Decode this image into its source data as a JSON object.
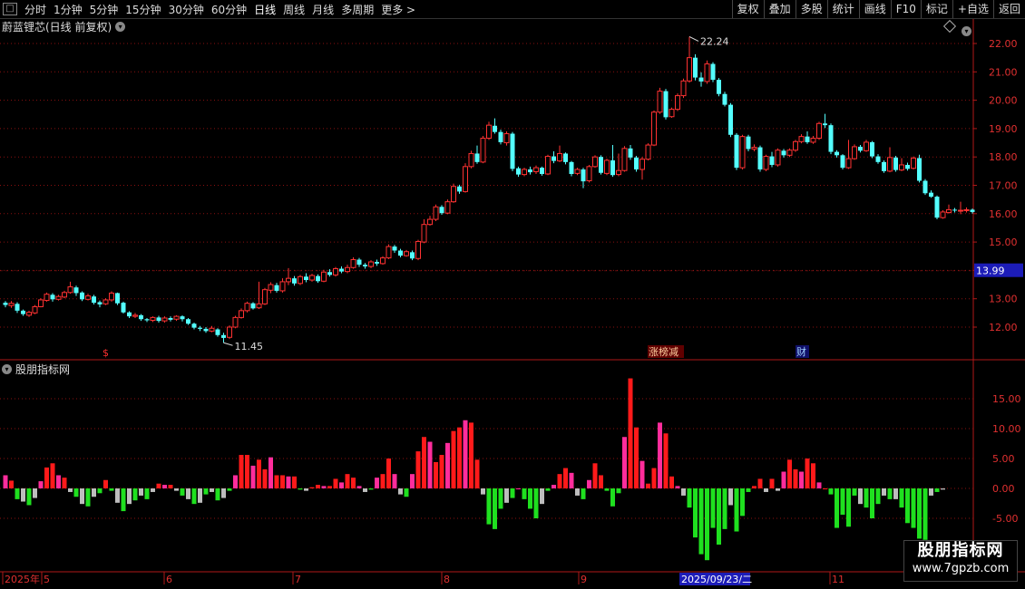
{
  "toolbar": {
    "periods": [
      "分时",
      "1分钟",
      "5分钟",
      "15分钟",
      "30分钟",
      "60分钟",
      "日线",
      "周线",
      "月线",
      "多周期",
      "更多 >"
    ],
    "active": "日线",
    "right_buttons": [
      "复权",
      "叠加",
      "多股",
      "统计",
      "画线",
      "F10",
      "标记",
      "+自选",
      "返回"
    ]
  },
  "title": "蔚蓝锂芯(日线 前复权)",
  "indicator_title": "股朋指标网",
  "price_axis": [
    "22.00",
    "21.00",
    "20.00",
    "19.00",
    "18.00",
    "17.00",
    "16.00",
    "15.00",
    "14.00",
    "13.00",
    "12.00"
  ],
  "indicator_axis": [
    "15.00",
    "10.00",
    "5.00",
    "0.00",
    "-5.00"
  ],
  "current_price": "13.99",
  "high_label": "22.24",
  "low_label": "11.45",
  "markers": {
    "s": "$",
    "zhang": "涨榜减",
    "cai": "财"
  },
  "time_axis": [
    "2025年",
    "5",
    "6",
    "7",
    "8",
    "9",
    "10",
    "11"
  ],
  "crosshair_date": "2025/09/23/二",
  "watermark": {
    "line1": "股朋指标网",
    "line2": "www.7gpzb.com"
  },
  "colors": {
    "up": "#ff3232",
    "down": "#54ffff",
    "pos": "#ff1a1a",
    "pos2": "#ff2d9c",
    "neg": "#1fe01f",
    "neu": "#bdbdbd",
    "grid": "#8a1010"
  },
  "chart_data": {
    "type": "candlestick",
    "ylim_price": [
      11.1,
      22.5
    ],
    "ylim_indicator": [
      -12.5,
      20
    ],
    "candles": [
      [
        12.86,
        12.78,
        12.92,
        12.7
      ],
      [
        12.76,
        12.84,
        12.92,
        12.68
      ],
      [
        12.82,
        12.58,
        12.88,
        12.5
      ],
      [
        12.58,
        12.46,
        12.62,
        12.4
      ],
      [
        12.42,
        12.52,
        12.58,
        12.36
      ],
      [
        12.5,
        12.72,
        12.78,
        12.46
      ],
      [
        12.72,
        12.96,
        13.02,
        12.7
      ],
      [
        12.94,
        13.16,
        13.22,
        12.9
      ],
      [
        13.14,
        12.98,
        13.2,
        12.9
      ],
      [
        12.98,
        13.08,
        13.14,
        12.94
      ],
      [
        13.06,
        13.22,
        13.28,
        13.02
      ],
      [
        13.22,
        13.42,
        13.6,
        13.18
      ],
      [
        13.4,
        13.2,
        13.46,
        13.1
      ],
      [
        13.22,
        12.98,
        13.26,
        12.92
      ],
      [
        12.98,
        13.1,
        13.18,
        12.94
      ],
      [
        13.08,
        12.86,
        13.14,
        12.8
      ],
      [
        12.88,
        12.8,
        12.94,
        12.7
      ],
      [
        12.82,
        12.96,
        13.02,
        12.78
      ],
      [
        12.96,
        13.2,
        13.26,
        12.9
      ],
      [
        13.2,
        12.84,
        13.22,
        12.78
      ],
      [
        12.86,
        12.52,
        12.9,
        12.48
      ],
      [
        12.52,
        12.38,
        12.56,
        12.32
      ],
      [
        12.38,
        12.42,
        12.5,
        12.32
      ],
      [
        12.42,
        12.28,
        12.46,
        12.22
      ],
      [
        12.28,
        12.24,
        12.32,
        12.18
      ],
      [
        12.24,
        12.34,
        12.38,
        12.18
      ],
      [
        12.34,
        12.22,
        12.4,
        12.16
      ],
      [
        12.22,
        12.32,
        12.38,
        12.16
      ],
      [
        12.32,
        12.26,
        12.38,
        12.2
      ],
      [
        12.28,
        12.38,
        12.42,
        12.22
      ],
      [
        12.38,
        12.28,
        12.42,
        12.2
      ],
      [
        12.28,
        12.12,
        12.32,
        12.08
      ],
      [
        12.12,
        11.98,
        12.16,
        11.92
      ],
      [
        11.98,
        11.94,
        12.04,
        11.86
      ],
      [
        11.94,
        11.86,
        12.0,
        11.8
      ],
      [
        11.86,
        11.96,
        12.04,
        11.82
      ],
      [
        11.92,
        11.72,
        11.96,
        11.66
      ],
      [
        11.72,
        11.62,
        11.8,
        11.45
      ],
      [
        11.64,
        12.0,
        12.06,
        11.58
      ],
      [
        12.0,
        12.34,
        12.4,
        11.96
      ],
      [
        12.34,
        12.58,
        12.66,
        12.3
      ],
      [
        12.58,
        12.84,
        12.9,
        12.52
      ],
      [
        12.84,
        12.66,
        12.88,
        12.62
      ],
      [
        12.68,
        12.82,
        13.6,
        12.64
      ],
      [
        12.82,
        13.32,
        13.38,
        12.78
      ],
      [
        13.3,
        13.5,
        13.58,
        13.2
      ],
      [
        13.48,
        13.28,
        13.56,
        13.22
      ],
      [
        13.28,
        13.6,
        13.72,
        13.22
      ],
      [
        13.6,
        13.72,
        14.08,
        13.48
      ],
      [
        13.72,
        13.54,
        13.8,
        13.46
      ],
      [
        13.54,
        13.78,
        13.84,
        13.48
      ],
      [
        13.78,
        13.66,
        13.9,
        13.58
      ],
      [
        13.66,
        13.82,
        13.88,
        13.6
      ],
      [
        13.8,
        13.62,
        13.86,
        13.56
      ],
      [
        13.62,
        13.94,
        14.02,
        13.58
      ],
      [
        13.94,
        13.84,
        14.04,
        13.78
      ],
      [
        13.84,
        14.06,
        14.12,
        13.78
      ],
      [
        14.06,
        13.96,
        14.14,
        13.9
      ],
      [
        13.96,
        14.1,
        14.2,
        13.9
      ],
      [
        14.1,
        14.38,
        14.46,
        14.06
      ],
      [
        14.38,
        14.2,
        14.44,
        14.12
      ],
      [
        14.2,
        14.14,
        14.26,
        14.06
      ],
      [
        14.14,
        14.3,
        14.36,
        14.08
      ],
      [
        14.3,
        14.24,
        14.38,
        14.16
      ],
      [
        14.24,
        14.44,
        14.5,
        14.2
      ],
      [
        14.44,
        14.84,
        14.92,
        14.4
      ],
      [
        14.84,
        14.7,
        14.9,
        14.62
      ],
      [
        14.7,
        14.52,
        14.76,
        14.46
      ],
      [
        14.52,
        14.66,
        14.72,
        14.48
      ],
      [
        14.64,
        14.42,
        14.7,
        14.36
      ],
      [
        14.42,
        15.02,
        15.08,
        14.36
      ],
      [
        15.0,
        15.62,
        15.8,
        14.96
      ],
      [
        15.62,
        15.8,
        15.92,
        15.58
      ],
      [
        15.8,
        16.24,
        16.32,
        15.74
      ],
      [
        16.24,
        16.02,
        16.3,
        15.96
      ],
      [
        16.02,
        16.42,
        16.5,
        15.98
      ],
      [
        16.42,
        16.96,
        17.06,
        16.38
      ],
      [
        16.96,
        16.78,
        17.02,
        16.7
      ],
      [
        16.78,
        17.66,
        17.78,
        16.74
      ],
      [
        17.66,
        18.12,
        18.22,
        17.6
      ],
      [
        18.12,
        17.82,
        18.4,
        17.76
      ],
      [
        17.82,
        18.66,
        18.74,
        17.78
      ],
      [
        18.66,
        19.12,
        19.24,
        18.6
      ],
      [
        19.1,
        18.88,
        19.36,
        18.82
      ],
      [
        18.88,
        18.52,
        18.96,
        18.44
      ],
      [
        18.5,
        18.82,
        18.9,
        18.4
      ],
      [
        18.82,
        17.58,
        18.88,
        17.5
      ],
      [
        17.6,
        17.38,
        17.66,
        17.3
      ],
      [
        17.38,
        17.56,
        17.62,
        17.32
      ],
      [
        17.56,
        17.46,
        17.66,
        17.38
      ],
      [
        17.48,
        17.62,
        17.7,
        17.4
      ],
      [
        17.62,
        17.4,
        17.66,
        17.34
      ],
      [
        17.4,
        18.02,
        18.08,
        17.36
      ],
      [
        18.02,
        17.86,
        18.2,
        17.78
      ],
      [
        17.86,
        18.12,
        18.4,
        17.82
      ],
      [
        18.12,
        17.82,
        18.16,
        17.74
      ],
      [
        17.82,
        17.4,
        17.86,
        17.32
      ],
      [
        17.42,
        17.56,
        17.62,
        17.36
      ],
      [
        17.56,
        17.14,
        17.62,
        16.9
      ],
      [
        17.16,
        17.66,
        17.72,
        17.1
      ],
      [
        17.66,
        18.0,
        18.06,
        17.62
      ],
      [
        18.0,
        17.44,
        18.06,
        17.38
      ],
      [
        17.42,
        17.88,
        17.94,
        17.36
      ],
      [
        17.88,
        17.36,
        18.42,
        17.3
      ],
      [
        17.38,
        17.52,
        18.12,
        17.32
      ],
      [
        17.52,
        18.3,
        18.38,
        17.48
      ],
      [
        18.3,
        17.98,
        18.42,
        17.9
      ],
      [
        17.98,
        17.56,
        18.04,
        17.48
      ],
      [
        17.56,
        17.92,
        18.0,
        17.2
      ],
      [
        17.92,
        18.42,
        18.48,
        17.88
      ],
      [
        18.42,
        19.58,
        19.64,
        18.38
      ],
      [
        19.58,
        20.32,
        20.44,
        19.52
      ],
      [
        20.32,
        19.4,
        20.4,
        19.32
      ],
      [
        19.42,
        19.68,
        19.74,
        19.38
      ],
      [
        19.68,
        20.16,
        20.24,
        19.62
      ],
      [
        20.16,
        20.68,
        20.76,
        20.08
      ],
      [
        20.68,
        21.5,
        22.24,
        20.62
      ],
      [
        21.5,
        20.8,
        21.62,
        20.7
      ],
      [
        20.8,
        20.66,
        20.98,
        20.48
      ],
      [
        20.66,
        21.28,
        21.4,
        20.58
      ],
      [
        21.28,
        20.72,
        21.34,
        20.64
      ],
      [
        20.72,
        20.22,
        20.78,
        20.14
      ],
      [
        20.22,
        19.84,
        20.3,
        19.78
      ],
      [
        19.84,
        18.78,
        19.9,
        18.7
      ],
      [
        18.78,
        17.62,
        18.84,
        17.54
      ],
      [
        17.62,
        18.72,
        18.78,
        17.56
      ],
      [
        18.72,
        18.28,
        18.78,
        18.2
      ],
      [
        18.28,
        18.34,
        18.44,
        18.2
      ],
      [
        18.34,
        17.56,
        18.4,
        17.48
      ],
      [
        17.56,
        18.02,
        18.08,
        17.5
      ],
      [
        18.02,
        17.72,
        18.18,
        17.64
      ],
      [
        17.72,
        18.24,
        18.3,
        17.66
      ],
      [
        18.22,
        18.06,
        18.28,
        17.98
      ],
      [
        18.06,
        18.24,
        18.3,
        18.0
      ],
      [
        18.24,
        18.54,
        18.6,
        18.18
      ],
      [
        18.54,
        18.72,
        18.8,
        18.48
      ],
      [
        18.72,
        18.52,
        18.9,
        18.46
      ],
      [
        18.52,
        18.66,
        18.74,
        18.46
      ],
      [
        18.66,
        19.18,
        19.24,
        18.6
      ],
      [
        19.18,
        19.12,
        19.52,
        19.02
      ],
      [
        19.12,
        18.18,
        19.18,
        18.1
      ],
      [
        18.18,
        18.06,
        18.24,
        17.98
      ],
      [
        18.06,
        17.62,
        18.1,
        17.56
      ],
      [
        17.62,
        17.94,
        18.6,
        17.58
      ],
      [
        17.94,
        18.36,
        18.44,
        17.9
      ],
      [
        18.36,
        18.22,
        18.42,
        18.16
      ],
      [
        18.22,
        18.52,
        18.6,
        18.18
      ],
      [
        18.52,
        18.02,
        18.56,
        17.96
      ],
      [
        18.02,
        17.82,
        18.1,
        17.76
      ],
      [
        17.82,
        17.5,
        17.88,
        17.44
      ],
      [
        17.5,
        17.98,
        18.34,
        17.46
      ],
      [
        17.98,
        17.54,
        18.04,
        17.48
      ],
      [
        17.54,
        17.72,
        17.96,
        17.5
      ],
      [
        17.72,
        17.58,
        17.8,
        17.52
      ],
      [
        17.6,
        17.96,
        18.02,
        17.56
      ],
      [
        17.96,
        17.16,
        18.08,
        17.1
      ],
      [
        17.16,
        16.72,
        17.22,
        16.66
      ],
      [
        16.74,
        16.6,
        16.82,
        16.56
      ],
      [
        16.6,
        15.86,
        16.64,
        15.8
      ],
      [
        15.86,
        16.06,
        16.12,
        15.82
      ],
      [
        16.04,
        16.14,
        16.32,
        16.0
      ],
      [
        16.14,
        16.12,
        16.2,
        16.04
      ],
      [
        16.12,
        16.12,
        16.42,
        15.98
      ],
      [
        16.12,
        16.14,
        16.22,
        16.04
      ],
      [
        16.14,
        16.06,
        16.18,
        16.0
      ]
    ],
    "indicator": [
      2.2,
      1.3,
      -1.8,
      -2.2,
      -2.8,
      -1.6,
      1.2,
      3.5,
      4.2,
      2.2,
      1.8,
      -0.6,
      -1.4,
      -2.6,
      -3.0,
      -1.4,
      -0.8,
      1.4,
      -0.4,
      -2.4,
      -3.8,
      -2.6,
      -2.0,
      -1.2,
      -1.8,
      -0.6,
      0.8,
      0.6,
      0.6,
      -0.4,
      -1.2,
      -1.8,
      -2.6,
      -2.4,
      -1.0,
      -0.6,
      -2.0,
      -1.6,
      -0.4,
      2.2,
      5.6,
      5.6,
      3.8,
      4.8,
      3.2,
      5.2,
      2.2,
      2.2,
      2.0,
      2.0,
      -0.2,
      -0.4,
      0.2,
      0.6,
      0.4,
      0.4,
      1.6,
      1.0,
      2.4,
      1.8,
      0.4,
      -0.6,
      -0.2,
      1.8,
      2.4,
      5.0,
      2.4,
      -1.0,
      -1.4,
      2.4,
      6.2,
      8.6,
      7.8,
      4.4,
      5.6,
      7.6,
      9.6,
      10.2,
      11.4,
      11.0,
      4.8,
      -1.0,
      -6.0,
      -6.8,
      -3.4,
      -2.4,
      -1.6,
      0.0,
      -1.8,
      -3.4,
      -5.0,
      -2.6,
      -0.4,
      0.6,
      2.4,
      3.4,
      2.6,
      -1.2,
      -1.8,
      1.4,
      4.2,
      2.2,
      -0.4,
      -3.0,
      -0.8,
      8.6,
      18.4,
      10.2,
      4.6,
      0.8,
      3.4,
      11.0,
      9.2,
      2.0,
      0.4,
      -1.2,
      -3.2,
      -8.2,
      -11.0,
      -12.0,
      -6.6,
      -9.4,
      -6.8,
      -2.8,
      -7.2,
      -4.6,
      -0.6,
      0.4,
      1.6,
      -0.6,
      1.6,
      -0.4,
      2.8,
      4.8,
      3.2,
      2.8,
      5.0,
      4.2,
      1.0,
      0.0,
      -1.0,
      -6.6,
      -4.4,
      -6.4,
      -1.2,
      -2.6,
      -3.2,
      -5.0,
      -2.6,
      -1.2,
      -1.8,
      -1.8,
      -3.2,
      -5.8,
      -6.6,
      -8.4,
      -8.6,
      -1.2,
      -0.6,
      -0.2
    ],
    "indicator_colors": "sign-based: positive red/pink, negative green or grey"
  }
}
